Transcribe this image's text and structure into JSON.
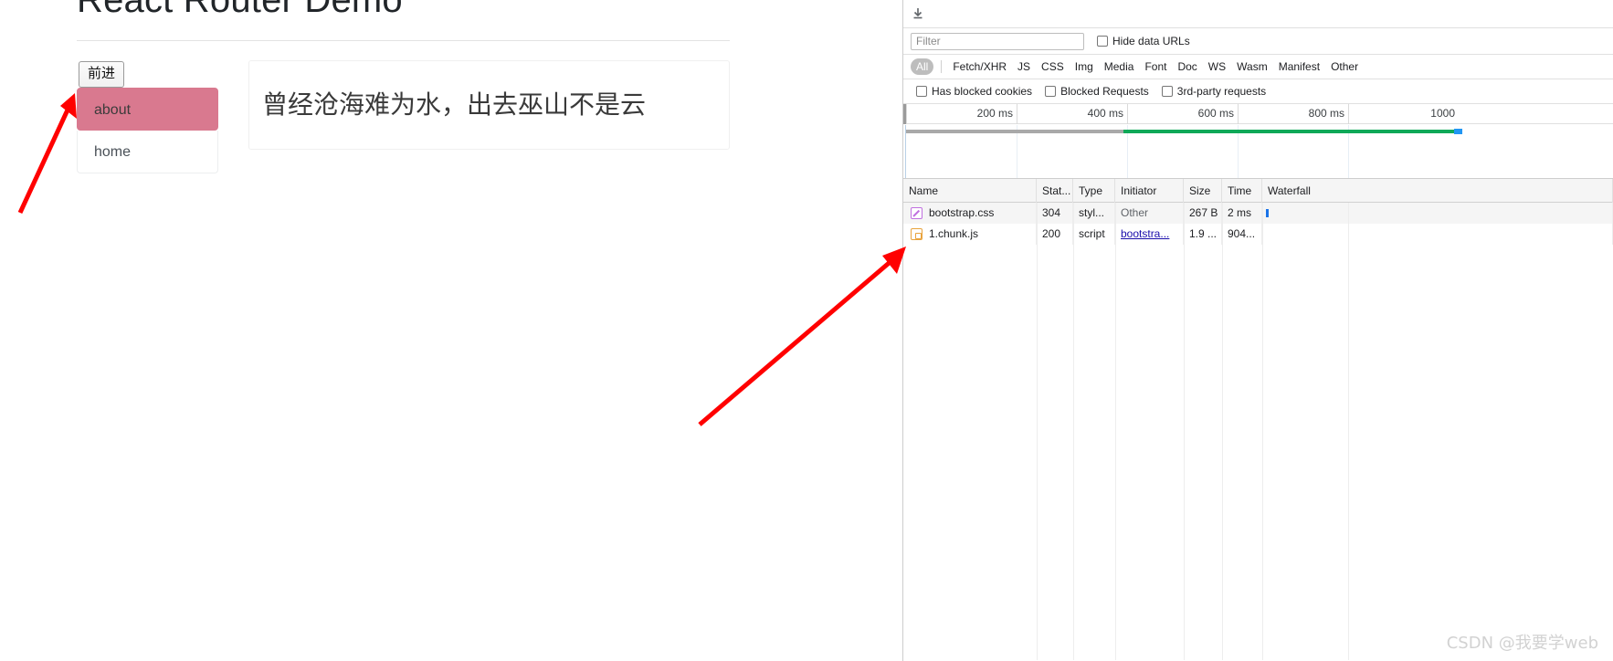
{
  "page": {
    "title": "React Router Demo",
    "forward_button": "前进",
    "nav_items": [
      {
        "label": "about",
        "active": true
      },
      {
        "label": "home",
        "active": false
      }
    ],
    "content_text": "曾经沧海难为水，出去巫山不是云"
  },
  "devtools": {
    "toolbar": {
      "download_icon": "download-icon"
    },
    "filter": {
      "placeholder": "Filter",
      "value": "",
      "hide_data_urls_label": "Hide data URLs",
      "hide_data_urls_checked": false
    },
    "resource_types": [
      {
        "label": "All",
        "active": true
      },
      {
        "label": "Fetch/XHR",
        "active": false
      },
      {
        "label": "JS",
        "active": false
      },
      {
        "label": "CSS",
        "active": false
      },
      {
        "label": "Img",
        "active": false
      },
      {
        "label": "Media",
        "active": false
      },
      {
        "label": "Font",
        "active": false
      },
      {
        "label": "Doc",
        "active": false
      },
      {
        "label": "WS",
        "active": false
      },
      {
        "label": "Wasm",
        "active": false
      },
      {
        "label": "Manifest",
        "active": false
      },
      {
        "label": "Other",
        "active": false
      }
    ],
    "request_filters": [
      {
        "label": "Has blocked cookies",
        "checked": false
      },
      {
        "label": "Blocked Requests",
        "checked": false
      },
      {
        "label": "3rd-party requests",
        "checked": false
      }
    ],
    "overview": {
      "ticks": [
        "200 ms",
        "400 ms",
        "600 ms",
        "800 ms",
        "1000"
      ],
      "bars": [
        {
          "color": "#a9a9a9",
          "name": "idle-network-bar"
        },
        {
          "color": "#0fa958",
          "name": "active-network-bar"
        },
        {
          "color": "#2196f3",
          "name": "dom-event-marker"
        }
      ]
    },
    "table": {
      "columns": [
        "Name",
        "Stat...",
        "Type",
        "Initiator",
        "Size",
        "Time",
        "Waterfall"
      ],
      "rows": [
        {
          "icon": "stylesheet-icon",
          "name": "bootstrap.css",
          "status": "304",
          "type": "styl...",
          "initiator": "Other",
          "initiator_is_link": false,
          "size": "267 B",
          "time": "2 ms"
        },
        {
          "icon": "script-icon",
          "name": "1.chunk.js",
          "status": "200",
          "type": "script",
          "initiator": "bootstra...",
          "initiator_is_link": true,
          "size": "1.9 ...",
          "time": "904..."
        }
      ]
    }
  },
  "watermark": "CSDN @我要学web",
  "colors": {
    "active_nav": "#d9798f",
    "annotation_arrow": "#ff0000",
    "network_active": "#0fa958",
    "network_idle": "#a9a9a9",
    "event_marker": "#2196f3"
  }
}
